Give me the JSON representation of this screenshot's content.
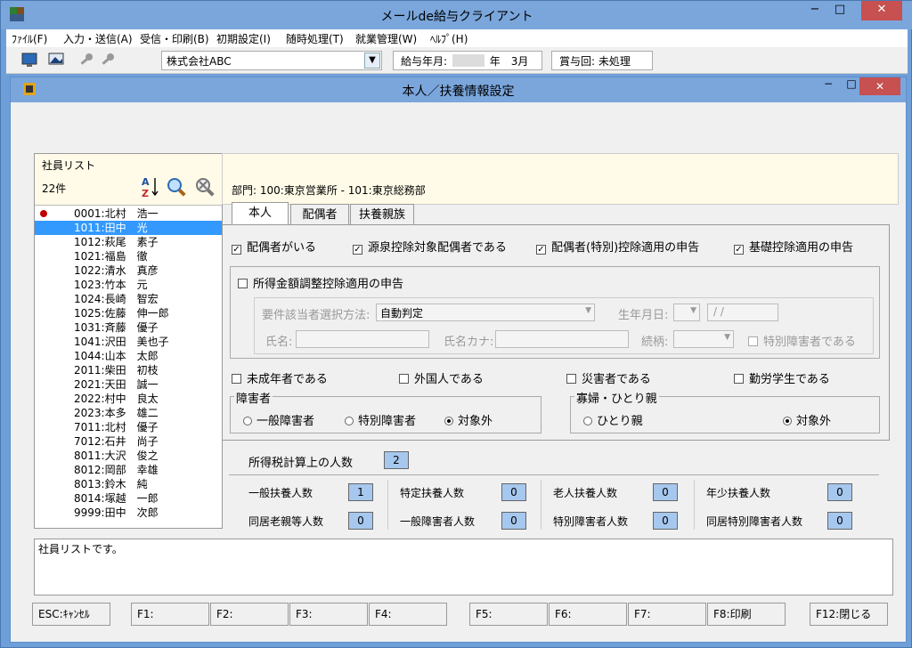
{
  "app": {
    "title": "メールde給与クライアント",
    "minimize": "−",
    "maximize": "□",
    "close": "✕"
  },
  "menu": [
    "ﾌｧｲﾙ(F)",
    "入力・送信(A)",
    "受信・印刷(B)",
    "初期設定(I)",
    "随時処理(T)",
    "就業管理(W)",
    "ﾍﾙﾌﾟ(H)"
  ],
  "toolbar": {
    "company": "株式会社ABC",
    "pay_month_label": "給与年月:",
    "pay_month_value": "年　3月",
    "bonus_label": "賞与回: 未処理"
  },
  "child": {
    "title": "本人／扶養情報設定",
    "minimize": "−",
    "maximize": "□",
    "close": "✕"
  },
  "employees": {
    "header": "社員リスト",
    "count": "22件",
    "items": [
      {
        "id": "0001",
        "name": "北村　浩一",
        "mark": true
      },
      {
        "id": "1011",
        "name": "田中　光",
        "selected": true
      },
      {
        "id": "1012",
        "name": "萩尾　素子"
      },
      {
        "id": "1021",
        "name": "福島　徹"
      },
      {
        "id": "1022",
        "name": "清水　真彦"
      },
      {
        "id": "1023",
        "name": "竹本　元"
      },
      {
        "id": "1024",
        "name": "長崎　智宏"
      },
      {
        "id": "1025",
        "name": "佐藤　伸一郎"
      },
      {
        "id": "1031",
        "name": "斉藤　優子"
      },
      {
        "id": "1041",
        "name": "沢田　美也子"
      },
      {
        "id": "1044",
        "name": "山本　太郎"
      },
      {
        "id": "2011",
        "name": "柴田　初枝"
      },
      {
        "id": "2021",
        "name": "天田　誠一"
      },
      {
        "id": "2022",
        "name": "村中　良太"
      },
      {
        "id": "2023",
        "name": "本多　雄二"
      },
      {
        "id": "7011",
        "name": "北村　優子"
      },
      {
        "id": "7012",
        "name": "石井　尚子"
      },
      {
        "id": "8011",
        "name": "大沢　俊之"
      },
      {
        "id": "8012",
        "name": "岡部　幸雄"
      },
      {
        "id": "8013",
        "name": "鈴木　純"
      },
      {
        "id": "8014",
        "name": "塚越　一郎"
      },
      {
        "id": "9999",
        "name": "田中　次郎"
      }
    ]
  },
  "dept": "部門:  100:東京営業所 - 101:東京総務部",
  "tabs": [
    "本人",
    "配偶者",
    "扶養親族"
  ],
  "checks": {
    "has_spouse": "配偶者がいる",
    "withholding_spouse": "源泉控除対象配偶者である",
    "special_spouse": "配偶者(特別)控除適用の申告",
    "basic": "基礎控除適用の申告",
    "income_adjust": "所得金額調整控除適用の申告",
    "minor": "未成年者である",
    "foreigner": "外国人である",
    "disaster": "災害者である",
    "student": "勤労学生である"
  },
  "adjust": {
    "method_label": "要件該当者選択方法:",
    "method_value": "自動判定",
    "birth_label": "生年月日:",
    "birth_value": "/ /",
    "name_label": "氏名:",
    "kana_label": "氏名カナ:",
    "relation_label": "続柄:",
    "special_disabled": "特別障害者である"
  },
  "disability": {
    "title": "障害者",
    "options": [
      "一般障害者",
      "特別障害者",
      "対象外"
    ],
    "selected": 2
  },
  "widow": {
    "title": "寡婦・ひとり親",
    "options": [
      "ひとり親",
      "対象外"
    ],
    "selected": 1
  },
  "counts": {
    "total_label": "所得税計算上の人数",
    "total_value": "2",
    "items": [
      {
        "label": "一般扶養人数",
        "value": "1"
      },
      {
        "label": "特定扶養人数",
        "value": "0"
      },
      {
        "label": "老人扶養人数",
        "value": "0"
      },
      {
        "label": "年少扶養人数",
        "value": "0"
      },
      {
        "label": "同居老親等人数",
        "value": "0"
      },
      {
        "label": "一般障害者人数",
        "value": "0"
      },
      {
        "label": "特別障害者人数",
        "value": "0"
      },
      {
        "label": "同居特別障害者人数",
        "value": "0"
      }
    ]
  },
  "status": "社員リストです。",
  "fkeys": [
    "ESC:ｷｬﾝｾﾙ",
    "F1:",
    "F2:",
    "F3:",
    "F4:",
    "F5:",
    "F6:",
    "F7:",
    "F8:印刷",
    "F12:閉じる"
  ]
}
